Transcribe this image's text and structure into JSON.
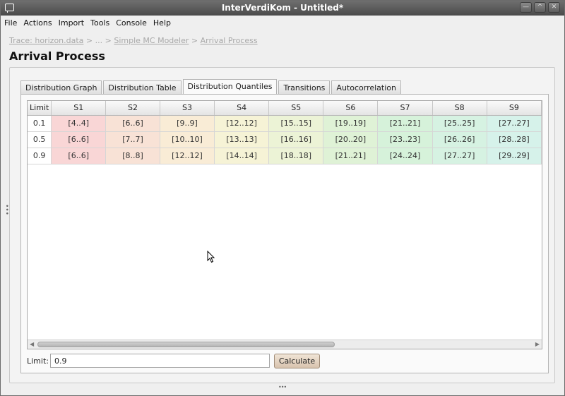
{
  "window": {
    "title": "InterVerdiKom - Untitled*",
    "buttons": [
      "minimize-icon",
      "maximize-icon",
      "close-icon"
    ]
  },
  "menu": [
    "File",
    "Actions",
    "Import",
    "Tools",
    "Console",
    "Help"
  ],
  "breadcrumb": {
    "items": [
      "Trace: horizon.data",
      "...",
      "Simple MC Modeler",
      "Arrival Process"
    ],
    "separator": ">"
  },
  "page_title": "Arrival Process",
  "tabs": [
    {
      "label": "Distribution Graph",
      "active": false
    },
    {
      "label": "Distribution Table",
      "active": false
    },
    {
      "label": "Distribution Quantiles",
      "active": true
    },
    {
      "label": "Transitions",
      "active": false
    },
    {
      "label": "Autocorrelation",
      "active": false
    }
  ],
  "table": {
    "columns": [
      "Limit",
      "S1",
      "S2",
      "S3",
      "S4",
      "S5",
      "S6",
      "S7",
      "S8",
      "S9"
    ],
    "column_colors": [
      "#ffffff",
      "#f9d6d6",
      "#f8e2d6",
      "#f9ecd6",
      "#f6f3d6",
      "#ecf3d6",
      "#dff2d6",
      "#d6f2da",
      "#d6f2e2",
      "#d6f2ea"
    ],
    "rows": [
      [
        "0.1",
        "[4..4]",
        "[6..6]",
        "[9..9]",
        "[12..12]",
        "[15..15]",
        "[19..19]",
        "[21..21]",
        "[25..25]",
        "[27..27]"
      ],
      [
        "0.5",
        "[6..6]",
        "[7..7]",
        "[10..10]",
        "[13..13]",
        "[16..16]",
        "[20..20]",
        "[23..23]",
        "[26..26]",
        "[28..28]"
      ],
      [
        "0.9",
        "[6..6]",
        "[8..8]",
        "[12..12]",
        "[14..14]",
        "[18..18]",
        "[21..21]",
        "[24..24]",
        "[27..27]",
        "[29..29]"
      ]
    ]
  },
  "limit_field": {
    "label": "Limit:",
    "value": "0.9"
  },
  "calculate_button": {
    "label": "Calculate"
  }
}
